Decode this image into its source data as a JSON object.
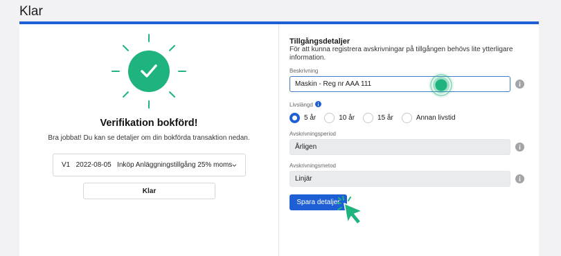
{
  "header": {
    "title": "Klar"
  },
  "left": {
    "success_icon": "check-circle-icon",
    "title": "Verifikation bokförd!",
    "description": "Bra jobbat! Du kan se detaljer om din bokförda transaktion nedan.",
    "verification_select": {
      "value": "V1   2022-08-05   Inköp Anläggningstillgång 25% moms",
      "icon": "chevron-down-icon"
    },
    "klar_button": "Klar"
  },
  "right": {
    "title": "Tillgångsdetaljer",
    "description": "För att kunna registrera avskrivningar på tillgången behövs lite ytterligare information.",
    "beskrivning": {
      "label": "Beskrivning",
      "value": "Maskin - Reg nr AAA 111"
    },
    "livslangd": {
      "label": "Livslängd",
      "options": [
        "5 år",
        "10 år",
        "15 år",
        "Annan livstid"
      ],
      "selected": "5 år"
    },
    "avskrivningsperiod": {
      "label": "Avskrivningsperiod",
      "value": "Årligen"
    },
    "avskrivningsmetod": {
      "label": "Avskrivningsmetod",
      "value": "Linjär"
    },
    "save_button": "Spara detaljer"
  },
  "colors": {
    "accent": "#1e5fd6",
    "success": "#1fb37e"
  }
}
